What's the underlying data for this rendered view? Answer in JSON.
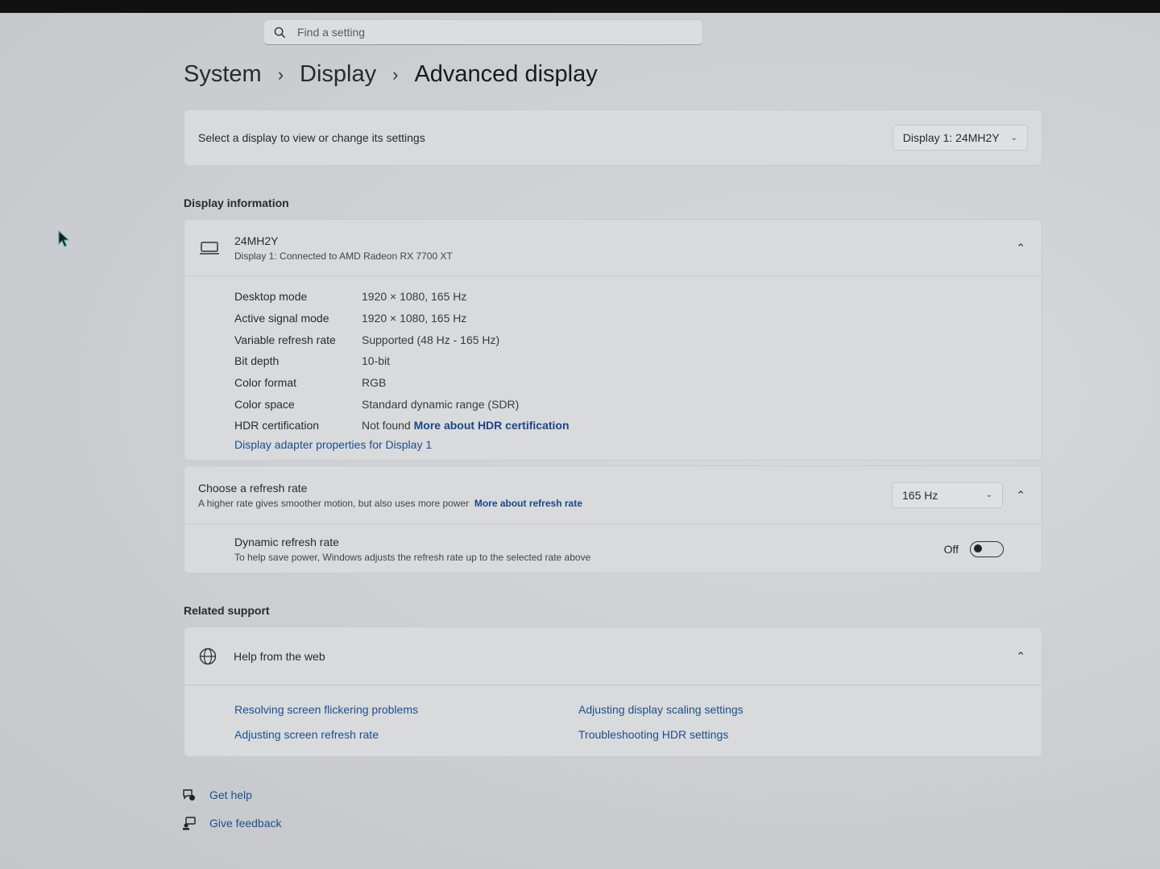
{
  "search": {
    "placeholder": "Find a setting"
  },
  "breadcrumb": {
    "items": [
      "System",
      "Display",
      "Advanced display"
    ]
  },
  "display_select": {
    "label": "Select a display to view or change its settings",
    "value": "Display 1: 24MH2Y"
  },
  "display_info": {
    "section_title": "Display information",
    "monitor_name": "24MH2Y",
    "monitor_subtitle": "Display 1: Connected to AMD Radeon RX 7700 XT",
    "rows": [
      {
        "key": "Desktop mode",
        "value": "1920 × 1080, 165 Hz"
      },
      {
        "key": "Active signal mode",
        "value": "1920 × 1080, 165 Hz"
      },
      {
        "key": "Variable refresh rate",
        "value": "Supported (48 Hz - 165 Hz)"
      },
      {
        "key": "Bit depth",
        "value": "10-bit"
      },
      {
        "key": "Color format",
        "value": "RGB"
      },
      {
        "key": "Color space",
        "value": "Standard dynamic range (SDR)"
      },
      {
        "key": "HDR certification",
        "value": "Not found",
        "link": "More about HDR certification"
      }
    ],
    "adapter_link": "Display adapter properties for Display 1"
  },
  "refresh": {
    "title": "Choose a refresh rate",
    "subtitle": "A higher rate gives smoother motion, but also uses more power",
    "link": "More about refresh rate",
    "value": "165 Hz",
    "dynamic_title": "Dynamic refresh rate",
    "dynamic_subtitle": "To help save power, Windows adjusts the refresh rate up to the selected rate above",
    "toggle_state": "Off"
  },
  "related": {
    "section_title": "Related support",
    "help_title": "Help from the web",
    "links": [
      "Resolving screen flickering problems",
      "Adjusting display scaling settings",
      "Adjusting screen refresh rate",
      "Troubleshooting HDR settings"
    ]
  },
  "footer": {
    "get_help": "Get help",
    "give_feedback": "Give feedback"
  }
}
